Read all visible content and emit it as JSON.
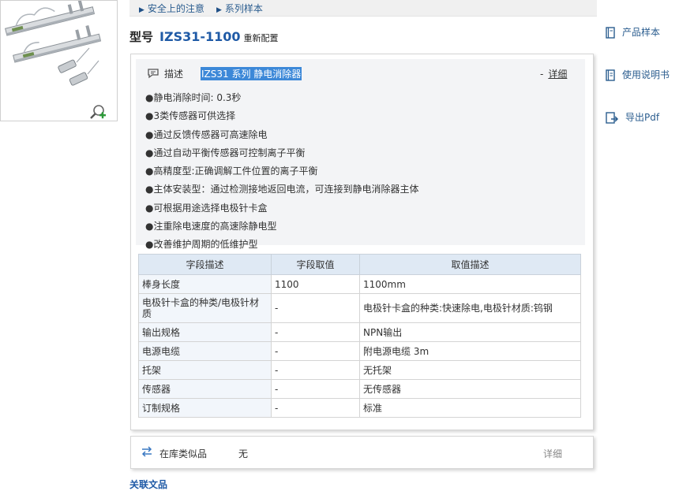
{
  "breadcrumb": {
    "items": [
      "安全上的注意",
      "系列样本"
    ]
  },
  "product": {
    "type_label": "型号",
    "model": "IZS31-1100",
    "config_label": "重新配置"
  },
  "description": {
    "label": "描述",
    "title": "IZS31 系列 静电消除器",
    "detail_prefix": "-",
    "detail_label": "详细",
    "features": [
      "●静电消除时间: 0.3秒",
      "●3类传感器可供选择",
      "●通过反馈传感器可高速除电",
      "●通过自动平衡传感器可控制离子平衡",
      "●高精度型:正确调解工件位置的离子平衡",
      "●主体安装型：通过检测接地返回电流，可连接到静电消除器主体",
      "●可根据用途选择电极针卡盒",
      "●注重除电速度的高速除静电型",
      "●改善维护周期的低维护型"
    ]
  },
  "spec_table": {
    "headers": [
      "字段描述",
      "字段取值",
      "取值描述"
    ],
    "rows": [
      [
        "棒身长度",
        "1100",
        "1100mm"
      ],
      [
        "电极针卡盒的种类/电极针材质",
        "-",
        "电极针卡盒的种类:快速除电,电极针材质:钨钢"
      ],
      [
        "输出规格",
        "-",
        "NPN输出"
      ],
      [
        "电源电缆",
        "-",
        "附电源电缆 3m"
      ],
      [
        "托架",
        "-",
        "无托架"
      ],
      [
        "传感器",
        "-",
        "无传感器"
      ],
      [
        "订制规格",
        "-",
        "标准"
      ]
    ]
  },
  "stock": {
    "label": "在库类似品",
    "value": "无",
    "detail_label": "详细"
  },
  "related": {
    "label": "关联文品"
  },
  "side_links": [
    {
      "label": "产品样本",
      "icon": "book-icon"
    },
    {
      "label": "使用说明书",
      "icon": "manual-icon"
    },
    {
      "label": "导出Pdf",
      "icon": "pdf-export-icon"
    }
  ],
  "colors": {
    "accent": "#1f5aa6",
    "highlight": "#3c88d8",
    "table_header": "#dfe9f4"
  }
}
